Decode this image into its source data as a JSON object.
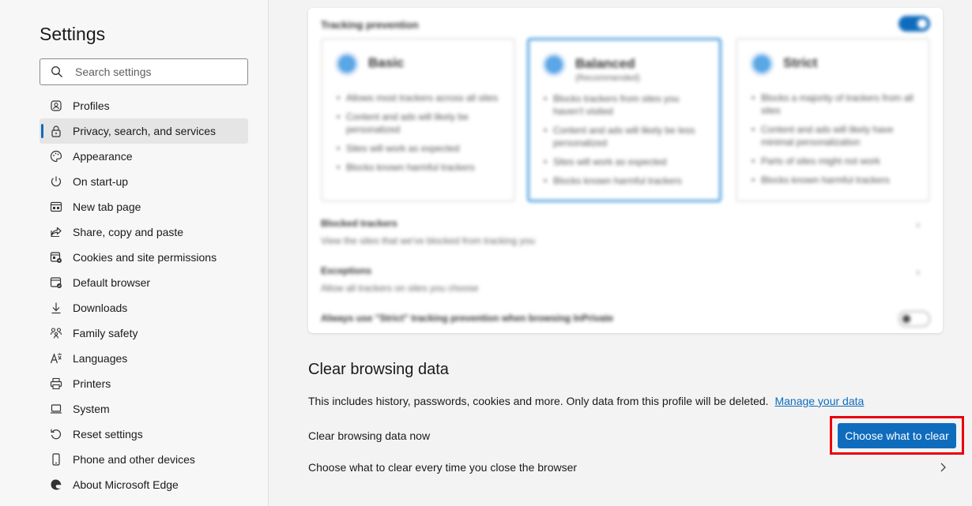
{
  "sidebar": {
    "title": "Settings",
    "search_placeholder": "Search settings",
    "items": [
      {
        "label": "Profiles",
        "icon": "profile-icon"
      },
      {
        "label": "Privacy, search, and services",
        "icon": "lock-icon",
        "active": true
      },
      {
        "label": "Appearance",
        "icon": "palette-icon"
      },
      {
        "label": "On start-up",
        "icon": "power-icon"
      },
      {
        "label": "New tab page",
        "icon": "newtab-icon"
      },
      {
        "label": "Share, copy and paste",
        "icon": "share-icon"
      },
      {
        "label": "Cookies and site permissions",
        "icon": "cookies-icon"
      },
      {
        "label": "Default browser",
        "icon": "browser-icon"
      },
      {
        "label": "Downloads",
        "icon": "download-icon"
      },
      {
        "label": "Family safety",
        "icon": "family-icon"
      },
      {
        "label": "Languages",
        "icon": "language-icon"
      },
      {
        "label": "Printers",
        "icon": "printer-icon"
      },
      {
        "label": "System",
        "icon": "system-icon"
      },
      {
        "label": "Reset settings",
        "icon": "reset-icon"
      },
      {
        "label": "Phone and other devices",
        "icon": "phone-icon"
      },
      {
        "label": "About Microsoft Edge",
        "icon": "edge-icon"
      }
    ]
  },
  "tracking": {
    "title": "Tracking prevention",
    "levels": [
      {
        "name": "Basic",
        "sub": "",
        "bullets": [
          "Allows most trackers across all sites",
          "Content and ads will likely be personalized",
          "Sites will work as expected",
          "Blocks known harmful trackers"
        ]
      },
      {
        "name": "Balanced",
        "sub": "(Recommended)",
        "bullets": [
          "Blocks trackers from sites you haven't visited",
          "Content and ads will likely be less personalized",
          "Sites will work as expected",
          "Blocks known harmful trackers"
        ]
      },
      {
        "name": "Strict",
        "sub": "",
        "bullets": [
          "Blocks a majority of trackers from all sites",
          "Content and ads will likely have minimal personalization",
          "Parts of sites might not work",
          "Blocks known harmful trackers"
        ]
      }
    ],
    "blocked_title": "Blocked trackers",
    "blocked_desc": "View the sites that we've blocked from tracking you",
    "exceptions_title": "Exceptions",
    "exceptions_desc": "Allow all trackers on sites you choose",
    "strict_inprivate": "Always use \"Strict\" tracking prevention when browsing InPrivate"
  },
  "clear_data": {
    "heading": "Clear browsing data",
    "description": "This includes history, passwords, cookies and more. Only data from this profile will be deleted.",
    "manage_link": "Manage your data",
    "now_label": "Clear browsing data now",
    "button_label": "Choose what to clear",
    "every_time_label": "Choose what to clear every time you close the browser"
  },
  "colors": {
    "accent": "#0f6cbd",
    "highlight": "#e8000d"
  }
}
